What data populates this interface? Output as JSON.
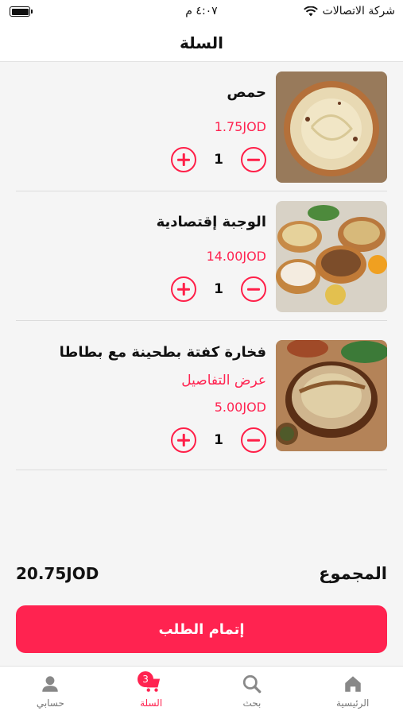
{
  "status_bar": {
    "carrier": "شركة الاتصالات",
    "time": "٤:٠٧ م"
  },
  "header": {
    "title": "السلة"
  },
  "items": [
    {
      "name": "حمص",
      "price": "1.75JOD",
      "quantity": "1",
      "image": "hummus"
    },
    {
      "name": "الوجبة إقتصادية",
      "price": "14.00JOD",
      "quantity": "1",
      "image": "meal"
    },
    {
      "name": "فخارة كفتة بطحينة مع بطاطا",
      "details_link": "عرض التفاصيل",
      "price": "5.00JOD",
      "quantity": "1",
      "image": "kofta"
    }
  ],
  "total": {
    "label": "المجموع",
    "value": "20.75JOD"
  },
  "checkout": {
    "label": "إتمام الطلب"
  },
  "tabbar": {
    "items": [
      {
        "label": "الرئيسية",
        "icon": "home-icon"
      },
      {
        "label": "بحث",
        "icon": "search-icon"
      },
      {
        "label": "السلة",
        "icon": "cart-icon",
        "badge": "3",
        "active": true
      },
      {
        "label": "حسابي",
        "icon": "user-icon"
      }
    ]
  },
  "colors": {
    "accent": "#ff2350",
    "background": "#f5f5f5"
  }
}
